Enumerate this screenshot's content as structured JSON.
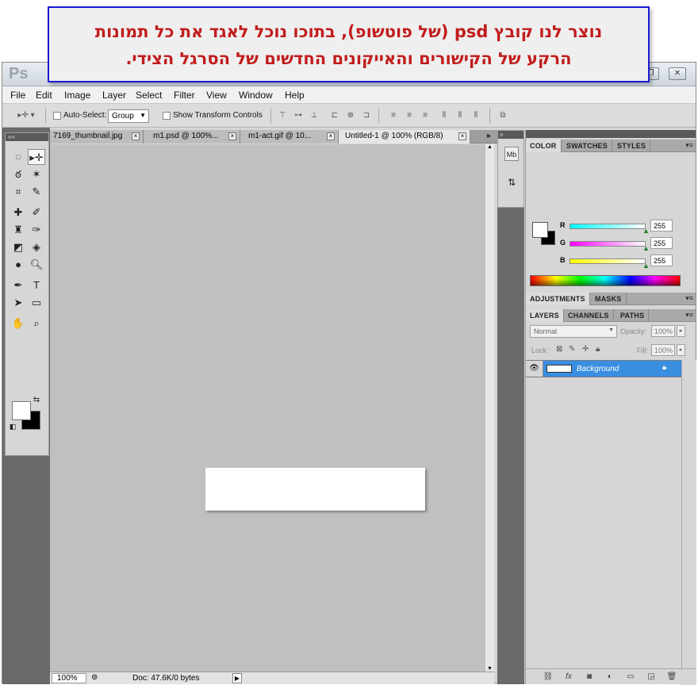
{
  "callout": {
    "line1": "נוצר לנו קובץ psd (של פוטשופ), בתוכו נוכל לאגד את כל תמונות",
    "line2": "הרקע של הקישורים והאייקונים החדשים של הסרגל הצידי."
  },
  "app": {
    "logo": "Ps"
  },
  "menu": [
    "File",
    "Edit",
    "Image",
    "Layer",
    "Select",
    "Filter",
    "View",
    "Window",
    "Help"
  ],
  "options": {
    "auto_select_label": "Auto-Select:",
    "auto_select_value": "Group",
    "transform_label": "Show Transform Controls"
  },
  "tabs": [
    {
      "label": "7169_thumbnail.jpg"
    },
    {
      "label": "m1.psd @ 100%..."
    },
    {
      "label": "m1-act.gif @ 10..."
    },
    {
      "label": "Untitled-1 @ 100% (RGB/8)"
    }
  ],
  "status": {
    "zoom": "100%",
    "doc": "Doc: 47.6K/0 bytes"
  },
  "color_panel": {
    "tabs": [
      "COLOR",
      "SWATCHES",
      "STYLES"
    ],
    "r_label": "R",
    "g_label": "G",
    "b_label": "B",
    "r": "255",
    "g": "255",
    "b": "255",
    "foreground": "#ffffff",
    "background": "#000000"
  },
  "adjust_panel": {
    "tabs": [
      "ADJUSTMENTS",
      "MASKS"
    ]
  },
  "layers_panel": {
    "tabs": [
      "LAYERS",
      "CHANNELS",
      "PATHS"
    ],
    "blend_mode": "Normal",
    "opacity_label": "Opacity:",
    "opacity": "100%",
    "lock_label": "Lock:",
    "fill_label": "Fill:",
    "fill": "100%",
    "layer_name": "Background"
  },
  "dock": {
    "mini_bridge": "Mb"
  }
}
